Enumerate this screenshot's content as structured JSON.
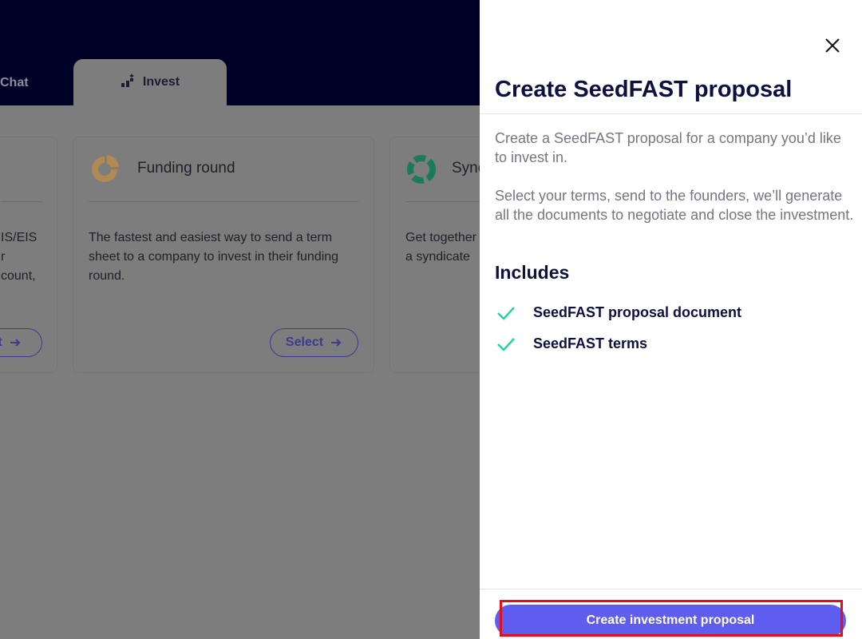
{
  "nav": {
    "tabs": [
      {
        "label": "Chat"
      },
      {
        "label": "Invest",
        "icon": "invest-icon"
      }
    ]
  },
  "cards": [
    {
      "title": "",
      "body_lines": [
        "IS/EIS",
        "r",
        "count,"
      ],
      "select_label": "t"
    },
    {
      "title": "Funding round",
      "icon": "pie-chart-icon",
      "body": "The fastest and easiest way to send a term sheet to a company to invest in their funding round.",
      "select_label": "Select"
    },
    {
      "title": "Sync",
      "icon": "syndicate-icon",
      "body_lines": [
        "Get together",
        "a syndicate"
      ]
    }
  ],
  "panel": {
    "title": "Create SeedFAST proposal",
    "intro": "Create a SeedFAST proposal for a company you’d like to invest in.",
    "details": "Select your terms, send to the founders, we’ll generate all the documents to negotiate and close the investment.",
    "includes_heading": "Includes",
    "includes": [
      "SeedFAST proposal document",
      "SeedFAST terms"
    ],
    "cta_label": "Create investment proposal"
  },
  "colors": {
    "topbar": "#000126",
    "accent": "#5e5df0",
    "check": "#1fd3a3",
    "highlight": "#e3101c"
  }
}
